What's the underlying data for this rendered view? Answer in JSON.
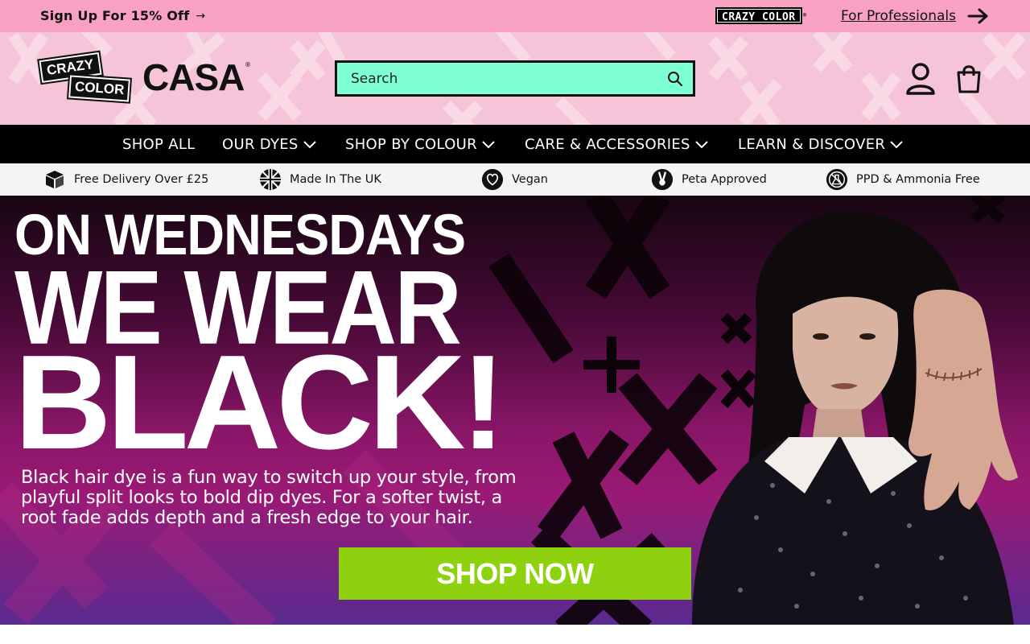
{
  "announcement": {
    "signup_label": "Sign Up For 15% Off",
    "signup_arrow": "→",
    "pro_logo_text": "CRAZY COLOR",
    "pro_logo_mark": "®",
    "pro_link_label": "For Professionals"
  },
  "header": {
    "logo_crazy": "CRAZY",
    "logo_color": "COLOR",
    "logo_casa": "CASA",
    "logo_reg": "®",
    "search_placeholder": "Search"
  },
  "nav": {
    "items": [
      {
        "label": "SHOP ALL",
        "has_dropdown": false
      },
      {
        "label": "OUR DYES",
        "has_dropdown": true
      },
      {
        "label": "SHOP BY COLOUR",
        "has_dropdown": true
      },
      {
        "label": "CARE & ACCESSORIES",
        "has_dropdown": true
      },
      {
        "label": "LEARN & DISCOVER",
        "has_dropdown": true
      }
    ]
  },
  "features": {
    "items": [
      {
        "label": "Free Delivery Over £25",
        "icon": "box-icon"
      },
      {
        "label": "Made In The UK",
        "icon": "union-jack-icon"
      },
      {
        "label": "Vegan",
        "icon": "heart-icon"
      },
      {
        "label": "Peta Approved",
        "icon": "bunny-icon"
      },
      {
        "label": "PPD & Ammonia Free",
        "icon": "no-chemicals-icon"
      }
    ]
  },
  "hero": {
    "line1": "ON WEDNESDAYS",
    "line2": "WE WEAR",
    "line3": "BLACK!",
    "description": "Black hair dye is a fun way to switch up your style, from playful split looks to bold dip dyes. For a softer twist, a root fade adds depth and a fresh edge to your hair.",
    "cta_label": "SHOP NOW"
  },
  "colors": {
    "announcement_bg": "#f9a1c2",
    "header_bg": "#f6c4d8",
    "search_bg": "#7fffd4",
    "nav_bg": "#000000",
    "features_bg": "#f4f4f4",
    "cta_bg": "#8ed20f"
  }
}
